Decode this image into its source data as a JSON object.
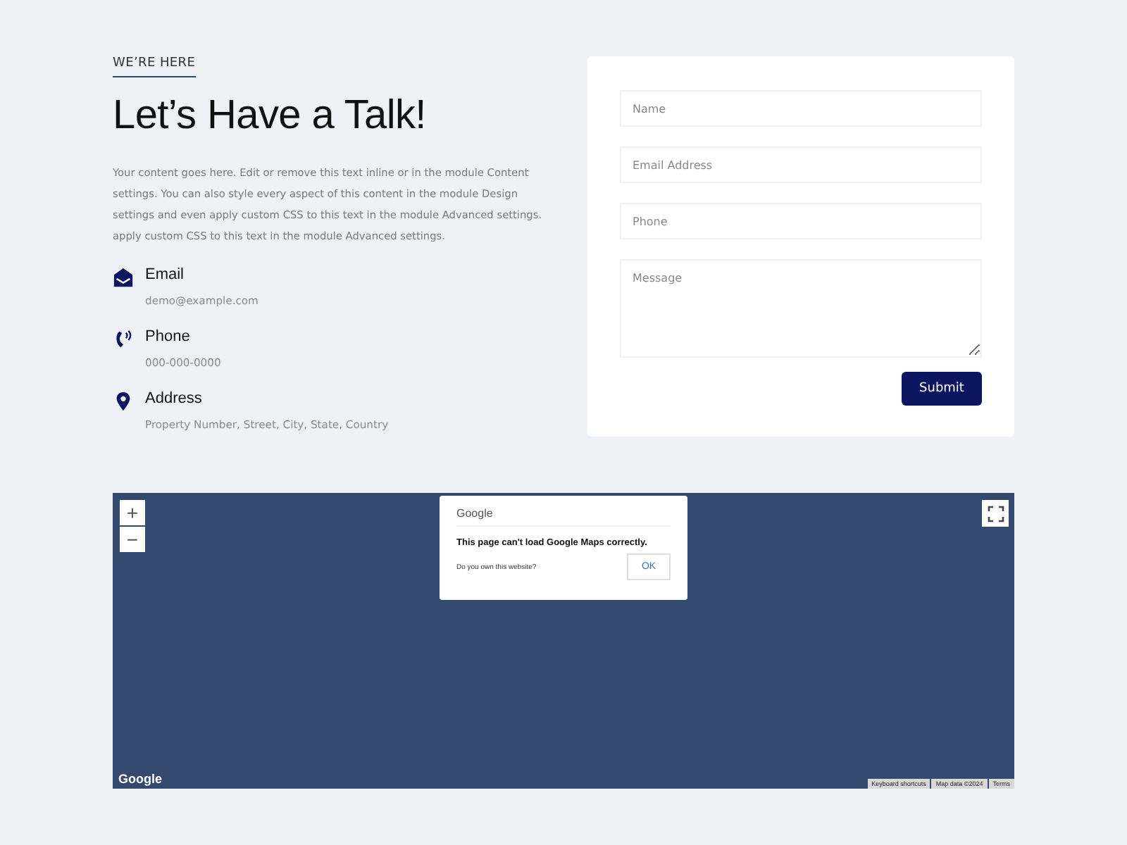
{
  "eyebrow": "WE’RE HERE",
  "heading": "Let’s Have a Talk!",
  "intro": "Your content goes here. Edit or remove this text inline or in the module Content settings. You can also style every aspect of this content in the module Design settings and even apply custom CSS to this text in the module Advanced settings. apply custom CSS to this text in the module Advanced settings.",
  "contacts": [
    {
      "kind": "email",
      "title": "Email",
      "detail": "demo@example.com"
    },
    {
      "kind": "phone",
      "title": "Phone",
      "detail": "000-000-0000"
    },
    {
      "kind": "address",
      "title": "Address",
      "detail": "Property Number, Street, City, State, Country"
    }
  ],
  "form": {
    "fields": [
      {
        "kind": "input",
        "placeholder": "Name"
      },
      {
        "kind": "input",
        "placeholder": "Email Address"
      },
      {
        "kind": "input",
        "placeholder": "Phone"
      },
      {
        "kind": "textarea",
        "placeholder": "Message"
      }
    ],
    "submit": "Submit"
  },
  "map": {
    "zoom_in": "+",
    "zoom_out": "−",
    "dialog": {
      "brand": "Google",
      "message": "This page can't load Google Maps correctly.",
      "question": "Do you own this website?",
      "ok": "OK"
    },
    "logo": "Google",
    "attribution": [
      "Keyboard shortcuts",
      "Map data ©2024",
      "Terms"
    ]
  }
}
